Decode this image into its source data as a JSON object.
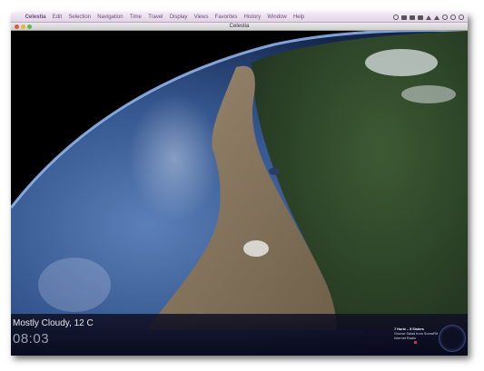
{
  "menubar": {
    "apple_glyph": "",
    "app_name": "Celestia",
    "items": [
      "Edit",
      "Selection",
      "Navigation",
      "Time",
      "Travel",
      "Display",
      "Views",
      "Favorites",
      "History",
      "Window",
      "Help"
    ]
  },
  "window": {
    "title": "Celestia"
  },
  "overlay": {
    "weather": "Mostly Cloudy, 12 C",
    "time": "08:03",
    "now_playing": {
      "track": "7 Hurtz – 5 Sisters",
      "line2": "Groove Salad from SomaFM",
      "line3": "Internet Radio"
    }
  },
  "colors": {
    "ocean": "#3a5f9a",
    "land": "#7a6a52",
    "forest": "#2f4a2a",
    "space": "#000000",
    "overlay_bar": "#0b0b1a"
  }
}
